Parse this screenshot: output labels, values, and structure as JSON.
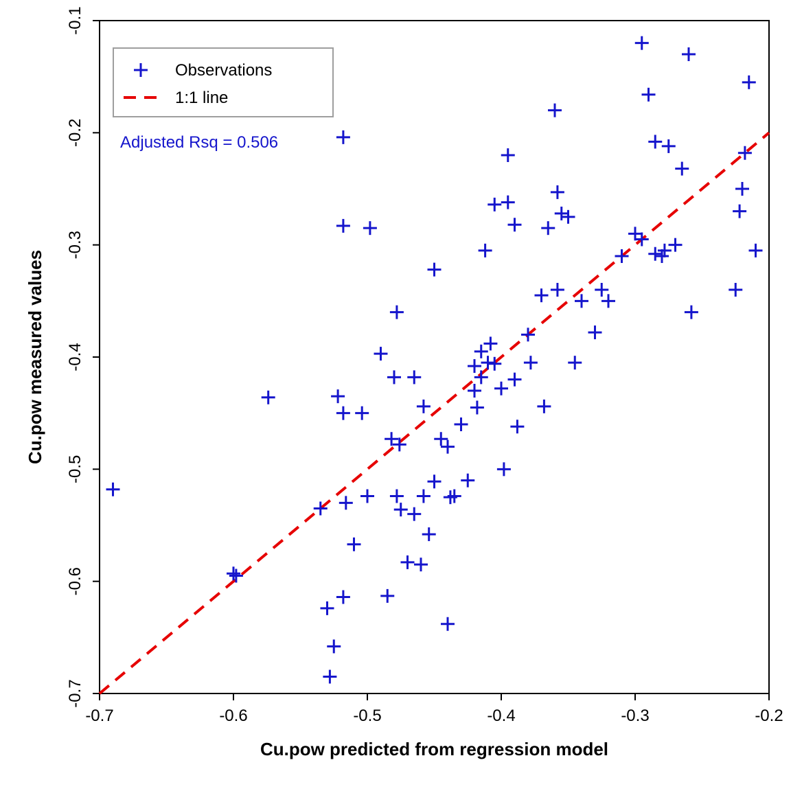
{
  "chart_data": {
    "type": "scatter",
    "title": "",
    "xlabel": "Cu.pow predicted from regression model",
    "ylabel": "Cu.pow measured values",
    "xlim": [
      -0.7,
      -0.2
    ],
    "ylim": [
      -0.7,
      -0.1
    ],
    "xticks": [
      -0.7,
      -0.6,
      -0.5,
      -0.4,
      -0.3,
      -0.2
    ],
    "yticks": [
      -0.7,
      -0.6,
      -0.5,
      -0.4,
      -0.3,
      -0.2,
      -0.1
    ],
    "annotation": "Adjusted Rsq = 0.506",
    "legend": {
      "items": [
        {
          "label": "Observations",
          "type": "point"
        },
        {
          "label": "1:1 line",
          "type": "dashed-line"
        }
      ]
    },
    "reference_line": {
      "slope": 1,
      "intercept": 0,
      "style": "dashed",
      "color": "#e60000"
    },
    "series": [
      {
        "name": "Observations",
        "x": [
          -0.69,
          -0.6,
          -0.598,
          -0.574,
          -0.535,
          -0.53,
          -0.528,
          -0.525,
          -0.522,
          -0.518,
          -0.518,
          -0.518,
          -0.518,
          -0.516,
          -0.51,
          -0.504,
          -0.5,
          -0.498,
          -0.49,
          -0.485,
          -0.482,
          -0.48,
          -0.478,
          -0.478,
          -0.476,
          -0.475,
          -0.47,
          -0.465,
          -0.465,
          -0.46,
          -0.458,
          -0.458,
          -0.454,
          -0.45,
          -0.45,
          -0.445,
          -0.44,
          -0.44,
          -0.438,
          -0.435,
          -0.43,
          -0.425,
          -0.42,
          -0.42,
          -0.418,
          -0.415,
          -0.415,
          -0.412,
          -0.41,
          -0.408,
          -0.405,
          -0.405,
          -0.4,
          -0.398,
          -0.395,
          -0.395,
          -0.39,
          -0.39,
          -0.388,
          -0.38,
          -0.378,
          -0.37,
          -0.368,
          -0.365,
          -0.36,
          -0.358,
          -0.358,
          -0.355,
          -0.35,
          -0.345,
          -0.34,
          -0.33,
          -0.325,
          -0.32,
          -0.31,
          -0.3,
          -0.295,
          -0.295,
          -0.29,
          -0.285,
          -0.285,
          -0.28,
          -0.278,
          -0.275,
          -0.27,
          -0.265,
          -0.26,
          -0.258,
          -0.225,
          -0.222,
          -0.22,
          -0.218,
          -0.215,
          -0.21
        ],
        "y": [
          -0.518,
          -0.593,
          -0.595,
          -0.436,
          -0.535,
          -0.624,
          -0.685,
          -0.658,
          -0.435,
          -0.204,
          -0.283,
          -0.45,
          -0.614,
          -0.53,
          -0.567,
          -0.45,
          -0.524,
          -0.285,
          -0.397,
          -0.613,
          -0.473,
          -0.418,
          -0.36,
          -0.524,
          -0.478,
          -0.536,
          -0.583,
          -0.418,
          -0.54,
          -0.585,
          -0.524,
          -0.444,
          -0.558,
          -0.322,
          -0.511,
          -0.473,
          -0.48,
          -0.638,
          -0.525,
          -0.524,
          -0.46,
          -0.51,
          -0.408,
          -0.43,
          -0.445,
          -0.395,
          -0.418,
          -0.305,
          -0.405,
          -0.388,
          -0.406,
          -0.264,
          -0.428,
          -0.5,
          -0.262,
          -0.22,
          -0.282,
          -0.42,
          -0.462,
          -0.38,
          -0.405,
          -0.345,
          -0.444,
          -0.285,
          -0.18,
          -0.253,
          -0.34,
          -0.272,
          -0.275,
          -0.405,
          -0.35,
          -0.378,
          -0.34,
          -0.35,
          -0.31,
          -0.29,
          -0.295,
          -0.12,
          -0.166,
          -0.208,
          -0.308,
          -0.31,
          -0.305,
          -0.212,
          -0.3,
          -0.232,
          -0.13,
          -0.36,
          -0.34,
          -0.27,
          -0.25,
          -0.218,
          -0.155,
          -0.305
        ]
      }
    ]
  }
}
